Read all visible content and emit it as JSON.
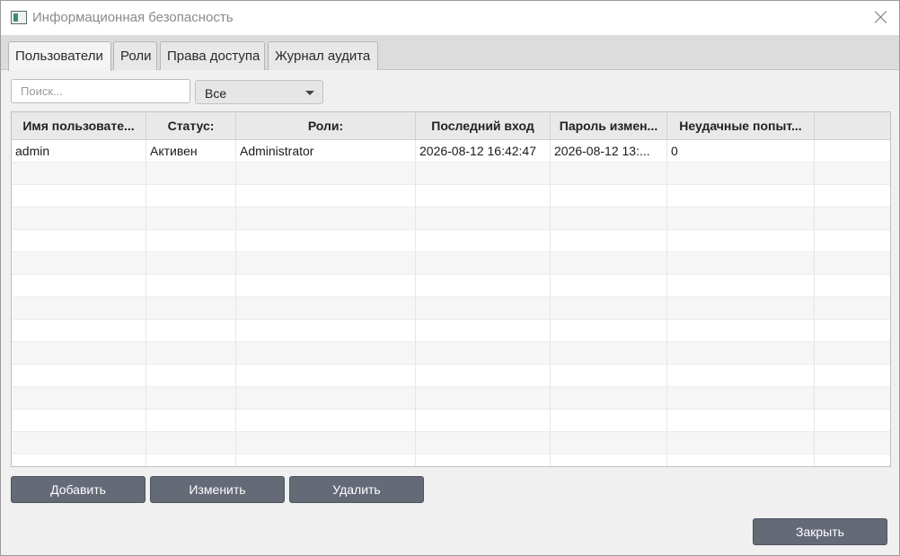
{
  "window": {
    "title": "Информационная безопасность"
  },
  "tabs": [
    {
      "label": "Пользователи",
      "active": true
    },
    {
      "label": "Роли",
      "active": false
    },
    {
      "label": "Права доступа",
      "active": false
    },
    {
      "label": "Журнал аудита",
      "active": false
    }
  ],
  "filters": {
    "search_placeholder": "Поиск...",
    "search_value": "",
    "status_selected": "Все"
  },
  "table": {
    "columns": [
      "Имя пользовате...",
      "Статус:",
      "Роли:",
      "Последний вход",
      "Пароль измен...",
      "Неудачные попыт...",
      ""
    ],
    "rows": [
      [
        "admin",
        "Активен",
        "Administrator",
        "2026-08-12 16:42:47",
        "2026-08-12 13:...",
        "0",
        ""
      ]
    ]
  },
  "buttons": {
    "add": "Добавить",
    "edit": "Изменить",
    "delete": "Удалить",
    "close": "Закрыть"
  },
  "colors": {
    "button_bg": "#656a77",
    "window_bg": "#f0f0f0",
    "header_bg": "#e9e9e9"
  }
}
